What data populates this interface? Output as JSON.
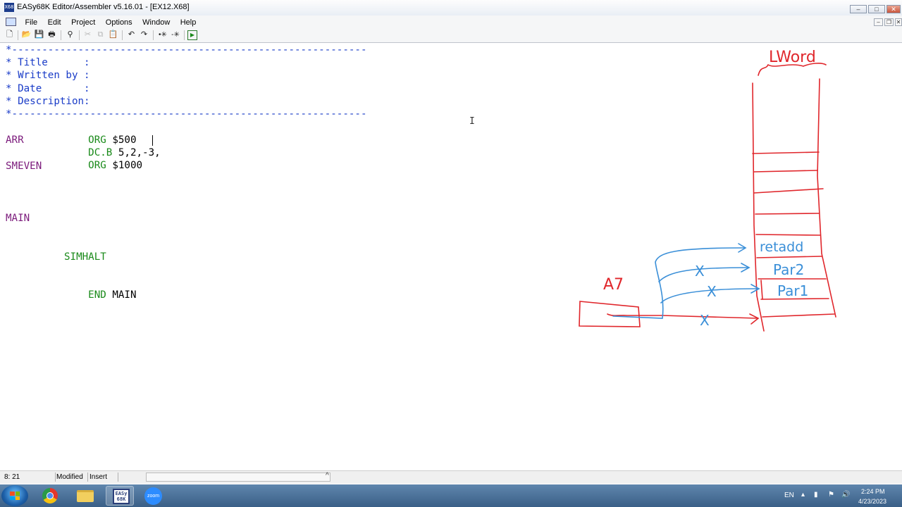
{
  "window": {
    "title": "EASy68K Editor/Assembler v5.16.01 - [EX12.X68]",
    "app_icon_text": "X68"
  },
  "menu": [
    "File",
    "Edit",
    "Project",
    "Options",
    "Window",
    "Help"
  ],
  "code": {
    "line1": "*-----------------------------------------------------------",
    "line2": "* Title      :",
    "line3": "* Written by :",
    "line4": "* Date       :",
    "line5": "* Description:",
    "line6": "*-----------------------------------------------------------",
    "org1_kw": "ORG",
    "org1_val": " $500",
    "arr_label": "ARR",
    "dcb_kw": "DC.B",
    "dcb_val": " 5,2,-3,",
    "org2_kw": "ORG",
    "org2_val": " $1000",
    "smeven_label": "SMEVEN",
    "main_label": "MAIN",
    "simhalt_kw": "SIMHALT",
    "end_kw": "END",
    "end_val": " MAIN"
  },
  "annotation": {
    "lword": "LWord",
    "a7": "A7",
    "retadd": "retadd",
    "par2": "Par2",
    "par1": "Par1",
    "cross": "X"
  },
  "status": {
    "position": "8: 21",
    "modified": "Modified",
    "mode": "Insert"
  },
  "tray": {
    "language": "EN",
    "time": "2:24 PM",
    "date": "4/23/2023"
  },
  "taskbar": {
    "easy_label": "EASy 68K",
    "zoom_label": "zoom"
  },
  "colors": {
    "comment": "#1a3cc8",
    "label": "#7b1a7b",
    "keyword": "#1a8a1a",
    "ink_red": "#e0262b",
    "ink_blue": "#3a8fd8"
  }
}
